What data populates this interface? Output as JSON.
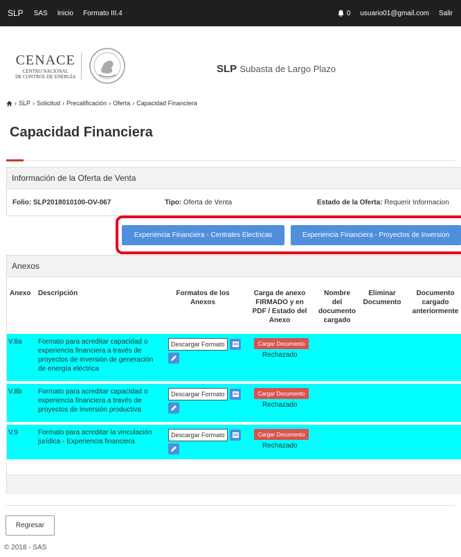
{
  "navbar": {
    "brand": "SLP",
    "links": [
      "SAS",
      "Inicio",
      "Formato III.4"
    ],
    "notifications_count": "0",
    "user_email": "usuario01@gmail.com",
    "logout": "Salir"
  },
  "header": {
    "cenace_big": "CENACE",
    "cenace_line1": "CENTRO NACIONAL",
    "cenace_line2": "DE CONTROL DE ENERGÍA",
    "app_short": "SLP",
    "app_long": "Subasta de Largo Plazo"
  },
  "breadcrumb": [
    "SLP",
    "Solicitud",
    "Precalificación",
    "Oferta",
    "Capacidad Financiera"
  ],
  "page_title": "Capacidad Financiera",
  "info_panel": {
    "title": "Información de la Oferta de Venta",
    "folio_label": "Folio:",
    "folio_value": "SLP2018010100-OV-067",
    "tipo_label": "Tipo:",
    "tipo_value": "Oferta de Venta",
    "estado_label": "Estado de la Oferta:",
    "estado_value": "Requerir Informacion"
  },
  "actions": {
    "btn_centrales": "Experiencia Financiera - Centrales Electricas",
    "btn_proyectos": "Experiencia Financiera - Proyectos de Inversion"
  },
  "anexos": {
    "title": "Anexos",
    "columns": {
      "anexo": "Anexo",
      "descripcion": "Descripción",
      "formatos": [
        "Formatos de los",
        "Anexos"
      ],
      "carga": [
        "Carga de anexo",
        "FIRMADO y en",
        "PDF / Estado del",
        "Anexo"
      ],
      "nombre": [
        "Nombre",
        "del",
        "documento",
        "cargado"
      ],
      "eliminar": [
        "Eliminar",
        "Documento"
      ],
      "documento": [
        "Documento",
        "cargado",
        "anteriormente"
      ]
    },
    "rows": [
      {
        "anexo": "V.8a",
        "descripcion": [
          "Formato para acreditar capacidad o",
          "experiencia financiera a través de",
          "proyectos de inversión de generación",
          "de energía eléctrica"
        ],
        "descargar": "Descargar Formato",
        "cargar": "Cargar Documento",
        "estado": "Rechazado"
      },
      {
        "anexo": "V.8b",
        "descripcion": [
          "Formato para acreditar capacidad o",
          "experiencia financiera a través de",
          "proyectos de inversión productiva"
        ],
        "descargar": "Descargar Formato",
        "cargar": "Cargar Documento",
        "estado": "Rechazado"
      },
      {
        "anexo": "V.9",
        "descripcion": [
          "Formato para acreditar la vinculación",
          "jurídica - Experiencia financiera"
        ],
        "descargar": "Descargar Formato",
        "cargar": "Cargar Documento",
        "estado": "Rechazado"
      }
    ]
  },
  "back_button": "Regresar",
  "copyright": "© 2018 - SAS",
  "colors": {
    "navbar": "#1f1f1f",
    "primary_button": "#4f8fdb",
    "danger_button": "#d9534f",
    "row_highlight": "#00ffff",
    "annotation_box": "#e8001c",
    "title_accent": "#c0392b"
  }
}
